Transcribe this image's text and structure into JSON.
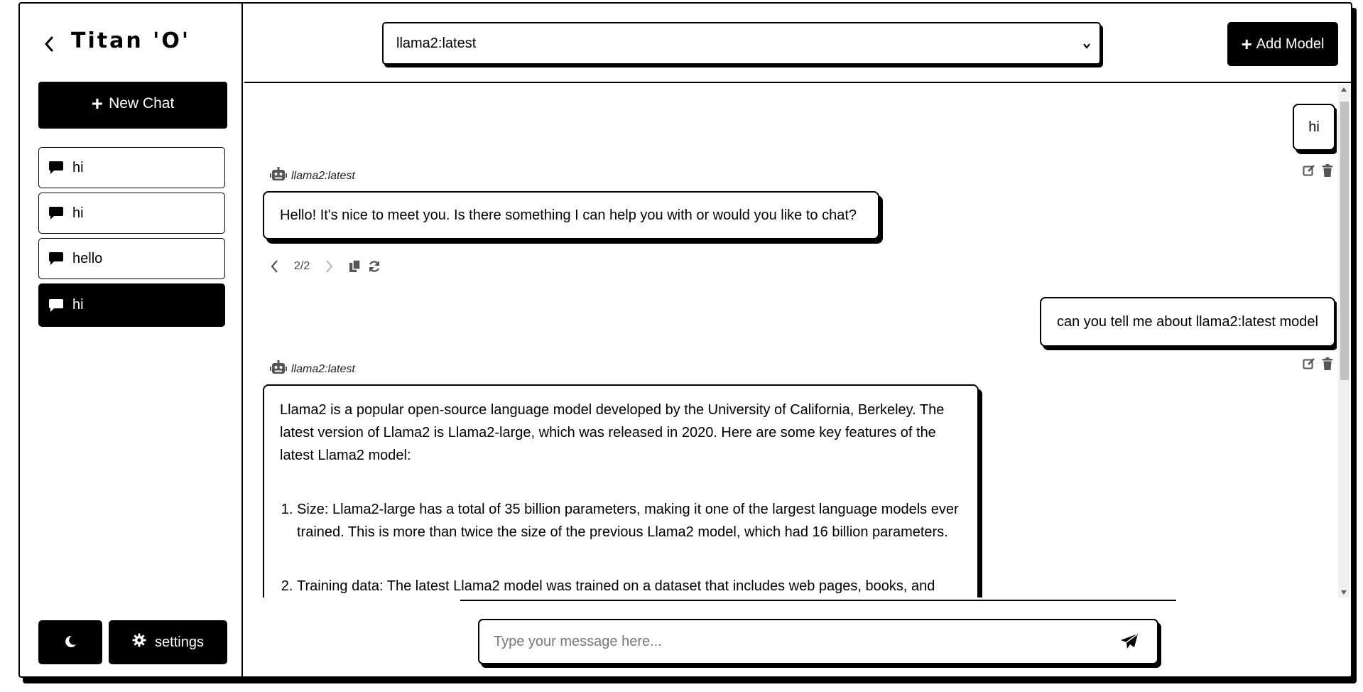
{
  "app": {
    "title": "Titan 'O'"
  },
  "sidebar": {
    "new_chat_label": "New Chat",
    "items": [
      {
        "label": "hi",
        "active": false
      },
      {
        "label": "hi",
        "active": false
      },
      {
        "label": "hello",
        "active": false
      },
      {
        "label": "hi",
        "active": true
      }
    ],
    "settings_label": "settings"
  },
  "header": {
    "selected_model": "llama2:latest",
    "add_model_label": "Add Model"
  },
  "messages": [
    {
      "role": "user",
      "text": "hi"
    },
    {
      "role": "assistant",
      "model": "llama2:latest",
      "text": "Hello! It's nice to meet you. Is there something I can help you with or would you like to chat?",
      "pager": "2/2"
    },
    {
      "role": "user",
      "text": "can you tell me about llama2:latest model"
    },
    {
      "role": "assistant",
      "model": "llama2:latest",
      "intro": "Llama2 is a popular open-source language model developed by the University of California, Berkeley. The latest version of Llama2 is Llama2-large, which was released in 2020. Here are some key features of the latest Llama2 model:",
      "list": [
        "Size: Llama2-large has a total of 35 billion parameters, making it one of the largest language models ever trained. This is more than twice the size of the previous Llama2 model, which had 16 billion parameters.",
        "Training data: The latest Llama2 model was trained on a dataset that includes web pages, books, and"
      ]
    }
  ],
  "composer": {
    "placeholder": "Type your message here..."
  },
  "icons": {
    "back": "chevron-left-icon",
    "chat": "chat-bubble-icon",
    "theme": "moon-icon",
    "settings": "gear-icon",
    "send": "paper-plane-icon",
    "edit": "edit-icon",
    "delete": "trash-icon",
    "bot": "robot-icon",
    "copy": "copy-icon",
    "regenerate": "refresh-icon"
  }
}
